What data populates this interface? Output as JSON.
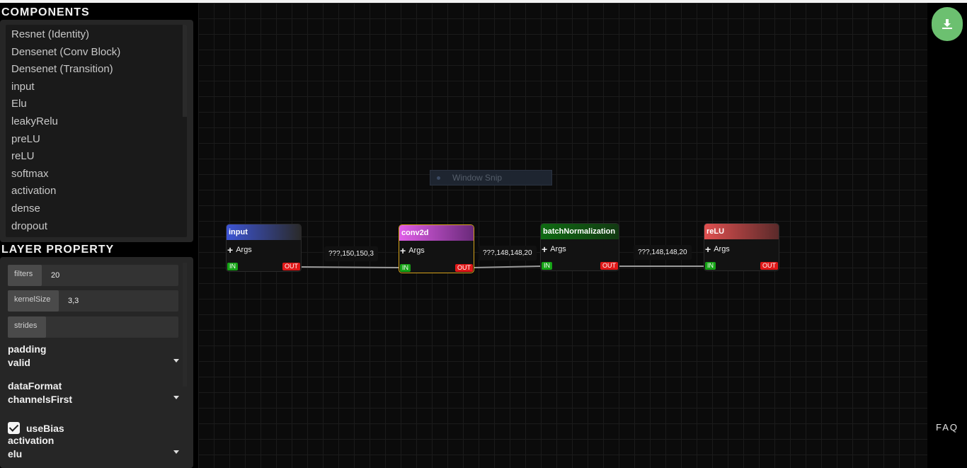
{
  "components": {
    "title": "COMPONENTS",
    "items": [
      "Resnet (Identity)",
      "Densenet (Conv Block)",
      "Densenet (Transition)",
      "input",
      "Elu",
      "leakyRelu",
      "preLU",
      "reLU",
      "softmax",
      "activation",
      "dense",
      "dropout"
    ]
  },
  "layer_property": {
    "title": "LAYER PROPERTY",
    "filters": {
      "label": "filters",
      "value": "20"
    },
    "kernelSize": {
      "label": "kernelSize",
      "value": "3,3"
    },
    "strides": {
      "label": "strides",
      "value": ""
    },
    "padding": {
      "label": "padding",
      "value": "valid"
    },
    "dataFormat": {
      "label": "dataFormat",
      "value": "channelsFirst"
    },
    "useBias": {
      "label": "useBias",
      "checked": true
    },
    "activation": {
      "label": "activation",
      "value": "elu"
    }
  },
  "canvas": {
    "overlay_text": "Window Snip",
    "nodes": [
      {
        "title": "input",
        "args": "Args",
        "in": "IN",
        "out": "OUT",
        "header_gradient": [
          "#3d55d6",
          "#2a2a2a"
        ]
      },
      {
        "title": "conv2d",
        "args": "Args",
        "in": "IN",
        "out": "OUT",
        "header_gradient": [
          "#e05ee8",
          "#6a2a7a"
        ]
      },
      {
        "title": "batchNormalization",
        "args": "Args",
        "in": "IN",
        "out": "OUT",
        "header_gradient": [
          "#0f6a12",
          "#123a12"
        ]
      },
      {
        "title": "reLU",
        "args": "Args",
        "in": "IN",
        "out": "OUT",
        "header_gradient": [
          "#e05050",
          "#5a2a2a"
        ]
      }
    ],
    "edges": [
      {
        "label": "???,150,150,3"
      },
      {
        "label": "???,148,148,20"
      },
      {
        "label": "???,148,148,20"
      }
    ]
  },
  "toolbar": {
    "download_icon": "download-icon",
    "faq_label": "FAQ"
  },
  "colors": {
    "accent": "#6cc070",
    "port_in": "#16a316",
    "port_out": "#e01818",
    "selected_border": "#d6a31a"
  }
}
